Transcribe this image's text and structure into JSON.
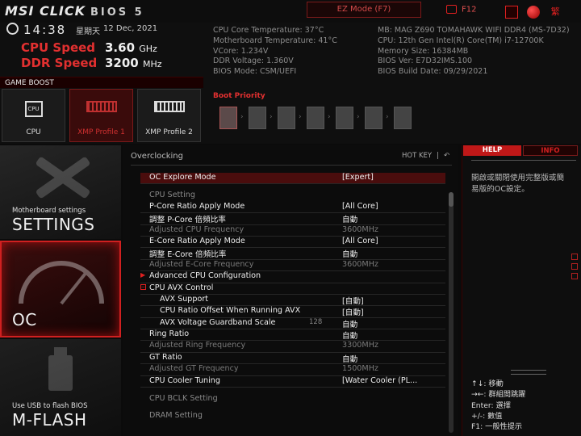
{
  "topbar": {
    "logo": "MSI CLICK",
    "logo_bios": "BIOS 5",
    "ez_mode": "EZ Mode (F7)",
    "f12": "F12",
    "icons": [
      "camera-icon",
      "search-icon",
      "language-globe-icon",
      "close-icon"
    ],
    "close_glyph": "繁"
  },
  "header": {
    "time": "14:38",
    "weekday": "星期天",
    "date": "12 Dec, 2021",
    "cpu_speed_label": "CPU Speed",
    "cpu_speed_value": "3.60",
    "cpu_speed_unit": "GHz",
    "ddr_speed_label": "DDR Speed",
    "ddr_speed_value": "3200",
    "ddr_speed_unit": "MHz",
    "info_left": [
      "CPU Core Temperature: 37°C",
      "Motherboard Temperature: 41°C",
      "VCore: 1.234V",
      "DDR Voltage: 1.360V",
      "BIOS Mode: CSM/UEFI"
    ],
    "info_right": [
      "MB: MAG Z690 TOMAHAWK WIFI DDR4 (MS-7D32)",
      "CPU: 12th Gen Intel(R) Core(TM) i7-12700K",
      "Memory Size: 16384MB",
      "BIOS Ver: E7D32IMS.100",
      "BIOS Build Date: 09/29/2021"
    ],
    "boot_priority_label": "Boot Priority",
    "boot_device_count": 7
  },
  "game_boost": {
    "label": "GAME BOOST",
    "tiles": [
      {
        "label": "CPU",
        "icon": "cpu-chip-icon",
        "chip_text": "CPU"
      },
      {
        "label": "XMP Profile 1",
        "icon": "ram-module-icon"
      },
      {
        "label": "XMP Profile 2",
        "icon": "ram-module-icon"
      }
    ]
  },
  "nav": {
    "settings_sub": "Motherboard settings",
    "settings_title": "SETTINGS",
    "oc_title": "OC",
    "mflash_sub": "Use USB to flash BIOS",
    "mflash_title": "M-FLASH"
  },
  "main": {
    "title": "Overclocking",
    "hotkey": "HOT KEY",
    "hotkey_sep": "|",
    "rows": [
      {
        "label": "OC Explore Mode",
        "value": "[Expert]",
        "type": "item"
      },
      {
        "label": "CPU  Setting",
        "value": "",
        "type": "header"
      },
      {
        "label": "P-Core Ratio Apply Mode",
        "value": "[All Core]",
        "type": "item"
      },
      {
        "label": "調整 P-Core 倍頻比率",
        "value": "自動",
        "type": "item"
      },
      {
        "label": "Adjusted CPU Frequency",
        "value": "3600MHz",
        "type": "dim"
      },
      {
        "label": "E-Core Ratio Apply Mode",
        "value": "[All Core]",
        "type": "item"
      },
      {
        "label": "調整 E-Core 倍頻比率",
        "value": "自動",
        "type": "item"
      },
      {
        "label": "Adjusted E-Core Frequency",
        "value": "3600MHz",
        "type": "dim"
      },
      {
        "label": "Advanced CPU Configuration",
        "value": "",
        "type": "item",
        "mark": "▶"
      },
      {
        "label": "CPU AVX Control",
        "value": "",
        "type": "item",
        "mark": "−"
      },
      {
        "label": "AVX Support",
        "value": "[自動]",
        "type": "sub"
      },
      {
        "label": "CPU Ratio Offset When Running AVX",
        "value": "[自動]",
        "type": "sub"
      },
      {
        "label": "AVX Voltage Guardband Scale",
        "value": "自動",
        "type": "sub",
        "extra": "128"
      },
      {
        "label": "Ring Ratio",
        "value": "自動",
        "type": "item"
      },
      {
        "label": "Adjusted Ring Frequency",
        "value": "3300MHz",
        "type": "dim"
      },
      {
        "label": "GT Ratio",
        "value": "自動",
        "type": "item"
      },
      {
        "label": "Adjusted GT Frequency",
        "value": "1500MHz",
        "type": "dim"
      },
      {
        "label": "CPU Cooler Tuning",
        "value": "[Water Cooler (PL...",
        "type": "item"
      },
      {
        "label": "CPU  BCLK  Setting",
        "value": "",
        "type": "header"
      },
      {
        "label": "DRAM  Setting",
        "value": "",
        "type": "header"
      }
    ]
  },
  "right_panel": {
    "tab_help": "HELP",
    "tab_info": "INFO",
    "help_text": "開啟或關閉使用完整版或簡易版的OC設定。",
    "keys": [
      "↑↓: 移動",
      "→←: 群組間跳躍",
      "Enter: 選擇",
      "+/-: 數值",
      "F1: 一般性提示"
    ]
  },
  "colors": {
    "accent_red": "#e02020",
    "selected_row": "#4a0d0d",
    "background": "#0b0b0b"
  }
}
